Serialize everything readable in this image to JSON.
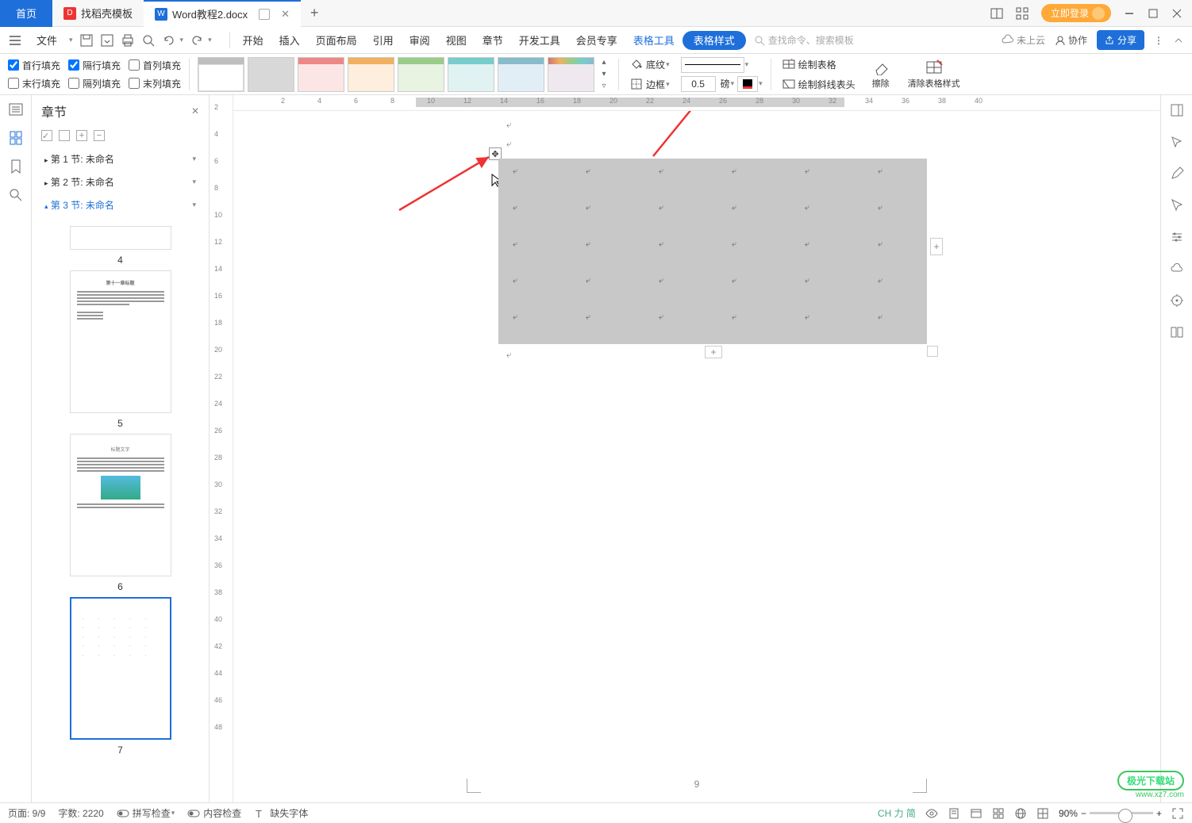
{
  "titlebar": {
    "home": "首页",
    "template": "找稻壳模板",
    "doc": "Word教程2.docx",
    "login": "立即登录"
  },
  "menubar": {
    "file": "文件",
    "items": [
      "开始",
      "插入",
      "页面布局",
      "引用",
      "审阅",
      "视图",
      "章节",
      "开发工具",
      "会员专享"
    ],
    "table_tools": "表格工具",
    "table_style": "表格样式",
    "search_ph": "查找命令、搜索模板",
    "not_uploaded": "未上云",
    "collab": "协作",
    "share": "分享"
  },
  "toolbar": {
    "checks_row1": [
      "首行填充",
      "隔行填充",
      "首列填充"
    ],
    "checks_row2": [
      "末行填充",
      "隔列填充",
      "末列填充"
    ],
    "checks_state_row1": [
      true,
      true,
      false
    ],
    "checks_state_row2": [
      false,
      false,
      false
    ],
    "shading": "底纹",
    "border": "边框",
    "border_width": "0.5",
    "border_unit": "磅",
    "draw_table": "绘制表格",
    "draw_diag": "绘制斜线表头",
    "eraser": "擦除",
    "clear_style": "清除表格样式"
  },
  "nav": {
    "title": "章节",
    "items": [
      {
        "label": "第 1 节: 未命名",
        "active": false
      },
      {
        "label": "第 2 节: 未命名",
        "active": false
      },
      {
        "label": "第 3 节: 未命名",
        "active": true
      }
    ],
    "thumbs": [
      "4",
      "5",
      "6",
      "7"
    ]
  },
  "ruler": {
    "h": [
      "2",
      "4",
      "6",
      "8",
      "10",
      "12",
      "14",
      "16",
      "18",
      "20",
      "22",
      "24",
      "26",
      "28",
      "30",
      "32",
      "34",
      "36",
      "38",
      "40"
    ],
    "v": [
      "2",
      "4",
      "6",
      "8",
      "10",
      "12",
      "14",
      "16",
      "18",
      "20",
      "22",
      "24",
      "26",
      "28",
      "30",
      "32",
      "34",
      "36",
      "38",
      "40",
      "42",
      "44",
      "46",
      "48"
    ]
  },
  "doc": {
    "page_number": "9"
  },
  "statusbar": {
    "page": "页面: 9/9",
    "words": "字数: 2220",
    "spell": "拼写检查",
    "content": "内容检查",
    "missing_font": "缺失字体",
    "ime": "CH 力 简",
    "zoom": "90%"
  },
  "watermark": {
    "l1": "极光下载站",
    "l2": "www.xz7.com"
  }
}
